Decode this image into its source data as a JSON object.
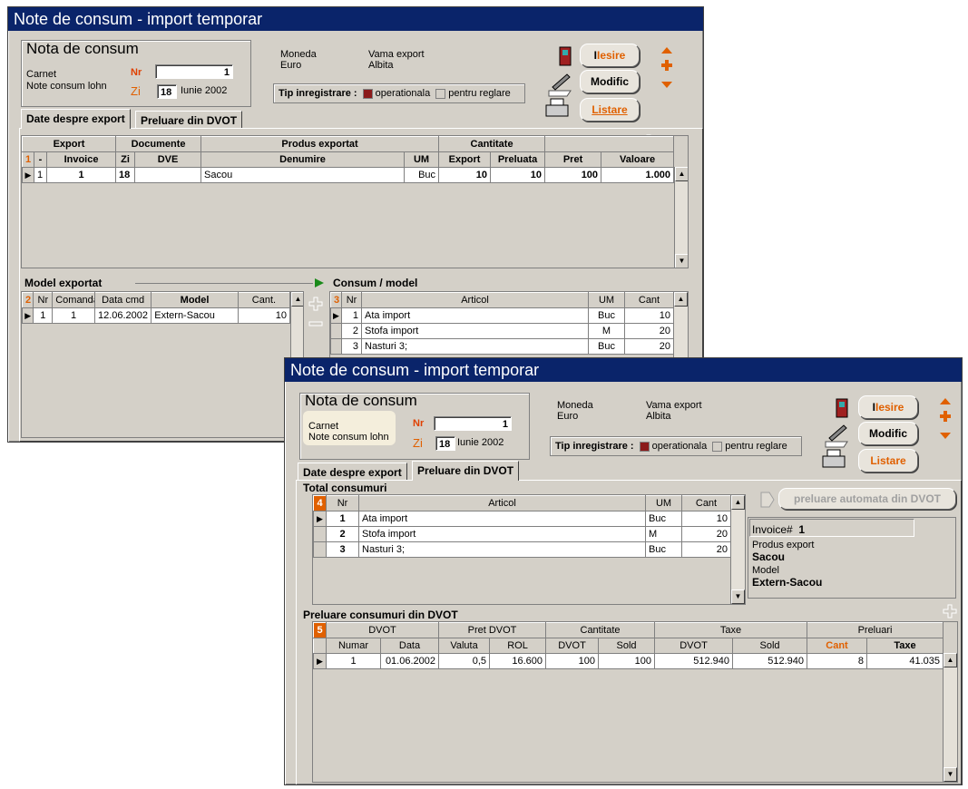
{
  "win1": {
    "title": "Note de consum - import temporar",
    "header": {
      "doc_title": "Nota de consum",
      "carnet_label": "Carnet",
      "carnet_value": "Note consum lohn",
      "nr_label": "Nr",
      "nr_value": "1",
      "zi_label": "Zi",
      "zi_day": "18",
      "zi_month": "Iunie 2002",
      "moneda_label": "Moneda",
      "moneda_value": "Euro",
      "vama_label": "Vama export",
      "vama_value": "Albita",
      "tip_label": "Tip inregistrare :",
      "tip_opt1": "operationala",
      "tip_opt2": "pentru reglare"
    },
    "buttons": {
      "iesire": "Iesire",
      "modific": "Modific",
      "listare": "Listare"
    },
    "tabs": [
      "Date despre export",
      "Preluare din DVOT"
    ],
    "grid1": {
      "group_headers": [
        "Export",
        "Documente",
        "Produs exportat",
        "Cantitate"
      ],
      "num": "1",
      "columns": [
        "-",
        "Invoice",
        "Zi",
        "DVE",
        "Denumire",
        "UM",
        "Export",
        "Preluata",
        "Pret",
        "Valoare"
      ],
      "rows": [
        [
          "1",
          "1",
          "18",
          "",
          "Sacou",
          "Buc",
          "10",
          "10",
          "100",
          "1.000"
        ]
      ]
    },
    "model_label": "Model exportat",
    "grid2": {
      "num": "2",
      "columns": [
        "Nr",
        "Comanda",
        "Data cmd",
        "Model",
        "Cant."
      ],
      "rows": [
        [
          "1",
          "1",
          "12.06.2002",
          "Extern-Sacou",
          "10"
        ]
      ]
    },
    "consum_label": "Consum / model",
    "grid3": {
      "num": "3",
      "columns": [
        "Nr",
        "Articol",
        "UM",
        "Cant"
      ],
      "rows": [
        [
          "1",
          "Ata import",
          "Buc",
          "10"
        ],
        [
          "2",
          "Stofa import",
          "M",
          "20"
        ],
        [
          "3",
          "Nasturi 3;",
          "Buc",
          "20"
        ]
      ]
    }
  },
  "win2": {
    "title": "Note de consum - import temporar",
    "header": {
      "doc_title": "Nota de consum",
      "carnet_label": "Carnet",
      "carnet_value": "Note consum lohn",
      "nr_label": "Nr",
      "nr_value": "1",
      "zi_label": "Zi",
      "zi_day": "18",
      "zi_month": "Iunie 2002",
      "moneda_label": "Moneda",
      "moneda_value": "Euro",
      "vama_label": "Vama export",
      "vama_value": "Albita",
      "tip_label": "Tip inregistrare :",
      "tip_opt1": "operationala",
      "tip_opt2": "pentru reglare"
    },
    "buttons": {
      "iesire": "Iesire",
      "modific": "Modific",
      "listare": "Listare"
    },
    "tabs": [
      "Date despre export",
      "Preluare din DVOT"
    ],
    "total_label": "Total consumuri",
    "grid4": {
      "num": "4",
      "columns": [
        "Nr",
        "Articol",
        "UM",
        "Cant"
      ],
      "rows": [
        [
          "1",
          "Ata import",
          "Buc",
          "10"
        ],
        [
          "2",
          "Stofa import",
          "M",
          "20"
        ],
        [
          "3",
          "Nasturi 3;",
          "Buc",
          "20"
        ]
      ]
    },
    "auto_button": "preluare automata din DVOT",
    "info": {
      "invoice_label": "Invoice#",
      "invoice_value": "1",
      "produs_label": "Produs export",
      "produs_value": "Sacou",
      "model_label": "Model",
      "model_value": "Extern-Sacou"
    },
    "preluare_label": "Preluare consumuri din DVOT",
    "grid5": {
      "num": "5",
      "group_headers": [
        "DVOT",
        "Pret DVOT",
        "Cantitate",
        "Taxe",
        "Preluari"
      ],
      "columns": [
        "Numar",
        "Data",
        "Valuta",
        "ROL",
        "DVOT",
        "Sold",
        "DVOT",
        "Sold",
        "Cant",
        "Taxe"
      ],
      "rows": [
        [
          "1",
          "01.06.2002",
          "0,5",
          "16.600",
          "100",
          "100",
          "512.940",
          "512.940",
          "8",
          "41.035"
        ]
      ]
    }
  }
}
